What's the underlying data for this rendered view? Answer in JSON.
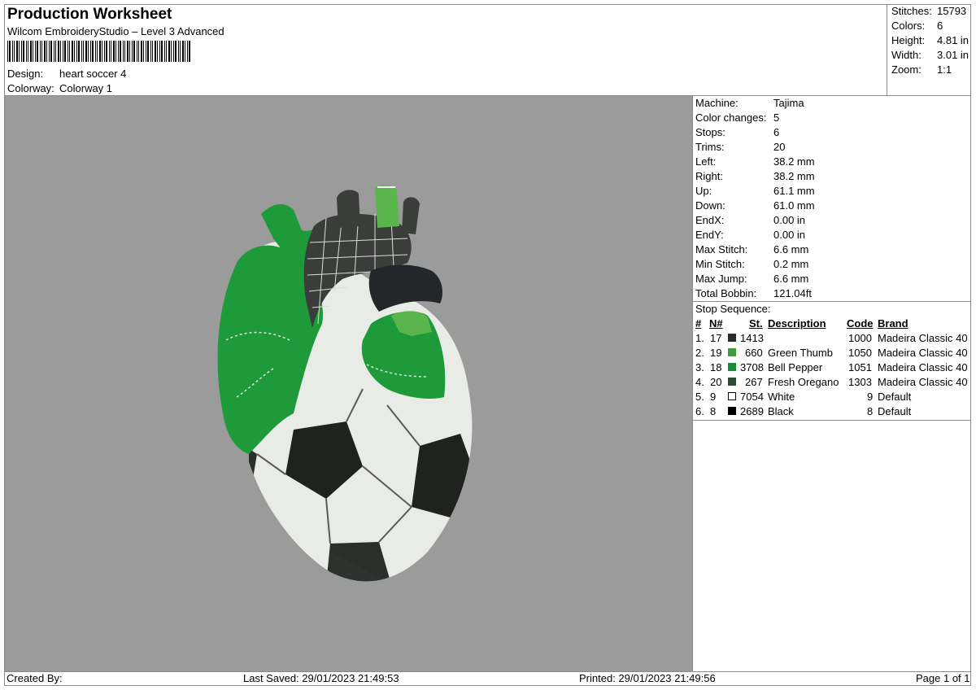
{
  "header": {
    "title": "Production Worksheet",
    "subtitle": "Wilcom EmbroideryStudio – Level 3 Advanced",
    "design_label": "Design:",
    "design_value": "heart soccer 4",
    "colorway_label": "Colorway:",
    "colorway_value": "Colorway 1"
  },
  "summary": [
    {
      "label": "Stitches:",
      "value": "15793"
    },
    {
      "label": "Colors:",
      "value": "6"
    },
    {
      "label": "Height:",
      "value": "4.81 in"
    },
    {
      "label": "Width:",
      "value": "3.01 in"
    },
    {
      "label": "Zoom:",
      "value": "1:1"
    }
  ],
  "params": [
    {
      "label": "Machine:",
      "value": "Tajima"
    },
    {
      "label": "Color changes:",
      "value": "5"
    },
    {
      "label": "Stops:",
      "value": "6"
    },
    {
      "label": "Trims:",
      "value": "20"
    },
    {
      "label": "Left:",
      "value": "38.2 mm"
    },
    {
      "label": "Right:",
      "value": "38.2 mm"
    },
    {
      "label": "Up:",
      "value": "61.1 mm"
    },
    {
      "label": "Down:",
      "value": "61.0 mm"
    },
    {
      "label": "EndX:",
      "value": "0.00 in"
    },
    {
      "label": "EndY:",
      "value": "0.00 in"
    },
    {
      "label": "Max Stitch:",
      "value": "6.6 mm"
    },
    {
      "label": "Min Stitch:",
      "value": "0.2 mm"
    },
    {
      "label": "Max Jump:",
      "value": "6.6 mm"
    },
    {
      "label": "Total Bobbin:",
      "value": "121.04ft"
    }
  ],
  "stop_sequence": {
    "title": "Stop Sequence:",
    "headers": {
      "num": "#",
      "n": "N#",
      "st": "St.",
      "desc": "Description",
      "code": "Code",
      "brand": "Brand"
    },
    "rows": [
      {
        "num": "1.",
        "n": "17",
        "color": "#2b2b2b",
        "st": "1413",
        "desc": "",
        "code": "1000",
        "brand": "Madeira Classic 40"
      },
      {
        "num": "2.",
        "n": "19",
        "color": "#3f9c3f",
        "st": "660",
        "desc": "Green Thumb",
        "code": "1050",
        "brand": "Madeira Classic 40"
      },
      {
        "num": "3.",
        "n": "18",
        "color": "#1a8c3a",
        "st": "3708",
        "desc": "Bell Pepper",
        "code": "1051",
        "brand": "Madeira Classic 40"
      },
      {
        "num": "4.",
        "n": "20",
        "color": "#2f4a32",
        "st": "267",
        "desc": "Fresh Oregano",
        "code": "1303",
        "brand": "Madeira Classic 40"
      },
      {
        "num": "5.",
        "n": "9",
        "color": "#ffffff",
        "st": "7054",
        "desc": "White",
        "code": "9",
        "brand": "Default"
      },
      {
        "num": "6.",
        "n": "8",
        "color": "#000000",
        "st": "2689",
        "desc": "Black",
        "code": "8",
        "brand": "Default"
      }
    ]
  },
  "footer": {
    "created_by": "Created By:",
    "last_saved": "Last Saved: 29/01/2023 21:49:53",
    "printed": "Printed: 29/01/2023 21:49:56",
    "page": "Page 1 of 1"
  },
  "preview": {
    "background": "#9b9b9b"
  }
}
